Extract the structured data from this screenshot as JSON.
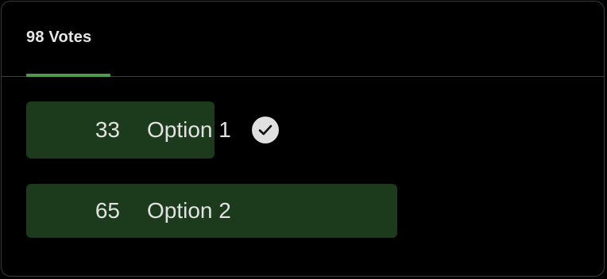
{
  "poll": {
    "total_votes_label": "98 Votes",
    "accent_color": "#4f9a4f",
    "bar_color": "#1c3a1c",
    "options": [
      {
        "count": "33",
        "label": "Option 1",
        "vote_share": 0.3367,
        "selected": true,
        "selected_icon": "checkmark-circle-icon"
      },
      {
        "count": "65",
        "label": "Option 2",
        "vote_share": 0.6633,
        "selected": false
      }
    ]
  }
}
